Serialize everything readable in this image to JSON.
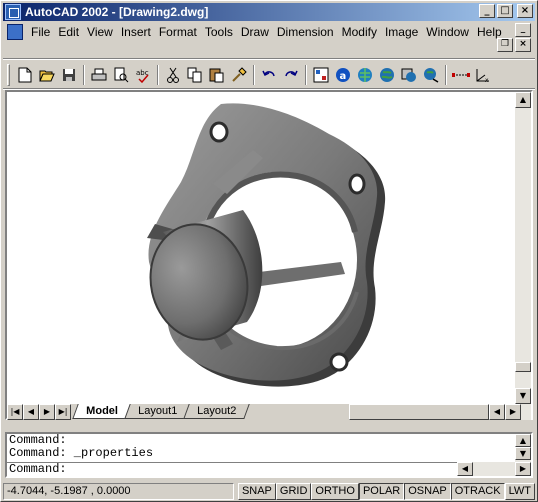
{
  "window": {
    "title": "AutoCAD 2002 - [Drawing2.dwg]",
    "controls": {
      "minimize": "_",
      "maximize": "□",
      "close": "×"
    }
  },
  "menubar": {
    "items": [
      {
        "label": "File"
      },
      {
        "label": "Edit"
      },
      {
        "label": "View"
      },
      {
        "label": "Insert"
      },
      {
        "label": "Format"
      },
      {
        "label": "Tools"
      },
      {
        "label": "Draw"
      },
      {
        "label": "Dimension"
      },
      {
        "label": "Modify"
      },
      {
        "label": "Image"
      },
      {
        "label": "Window"
      },
      {
        "label": "Help"
      }
    ],
    "doc_controls": {
      "minimize": "_",
      "restore": "❐",
      "close": "×"
    }
  },
  "toolbar": {
    "icons": [
      "new-icon",
      "open-icon",
      "save-icon",
      "print-icon",
      "print-preview-icon",
      "spell-check-icon",
      "cut-icon",
      "copy-icon",
      "paste-icon",
      "match-properties-icon",
      "undo-icon",
      "redo-icon",
      "properties-icon",
      "autodesk-icon",
      "web-icon",
      "globe-icon",
      "globe-2-icon",
      "globe-3-icon",
      "distance-icon",
      "ucs-icon"
    ]
  },
  "drawing": {
    "tabs": [
      {
        "label": "Model",
        "active": true
      },
      {
        "label": "Layout1",
        "active": false
      },
      {
        "label": "Layout2",
        "active": false
      }
    ]
  },
  "command": {
    "history": [
      "Command:",
      "Command: _properties"
    ],
    "prompt": "Command:"
  },
  "statusbar": {
    "coordinates": "-4.7044, -5.1987 , 0.0000",
    "buttons": [
      {
        "label": "SNAP"
      },
      {
        "label": "GRID"
      },
      {
        "label": "ORTHO"
      },
      {
        "label": "POLAR"
      },
      {
        "label": "OSNAP"
      },
      {
        "label": "OTRACK"
      },
      {
        "label": "LWT"
      }
    ]
  },
  "colors": {
    "title_start": "#0a246a",
    "title_end": "#a6caf0",
    "chrome": "#d4d0c8",
    "part": "#808080"
  }
}
